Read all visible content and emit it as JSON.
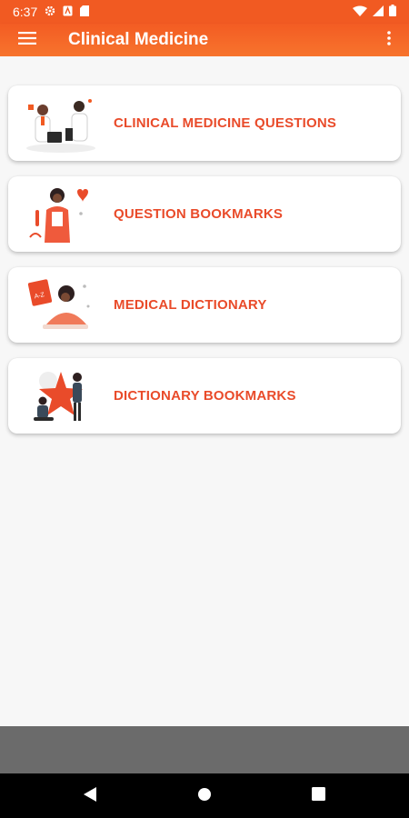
{
  "status_bar": {
    "time": "6:37"
  },
  "app_bar": {
    "title": "Clinical Medicine",
    "menu_icon": "hamburger-menu-icon",
    "more_icon": "more-vert-icon"
  },
  "menu": {
    "items": [
      {
        "label": "CLINICAL MEDICINE QUESTIONS",
        "illustration": "doctors-consult-illustration"
      },
      {
        "label": "QUESTION BOOKMARKS",
        "illustration": "nurse-heart-illustration"
      },
      {
        "label": "MEDICAL DICTIONARY",
        "illustration": "woman-reading-dictionary-illustration"
      },
      {
        "label": "DICTIONARY BOOKMARKS",
        "illustration": "people-star-illustration"
      }
    ]
  },
  "colors": {
    "primary": "#f15a22",
    "accent_text": "#e94b2a",
    "background": "#f7f7f7"
  }
}
